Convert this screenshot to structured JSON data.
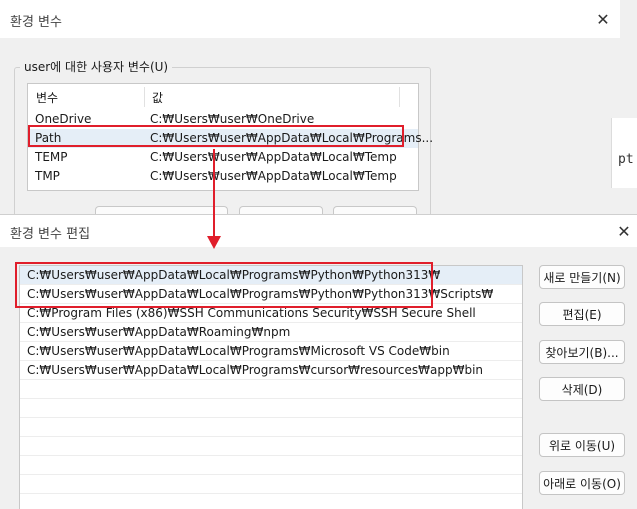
{
  "back_window": {
    "title": "환경 변수",
    "group_label": "user에 대한 사용자 변수(U)",
    "columns": {
      "name": "변수",
      "value": "값"
    },
    "rows": [
      {
        "name": "OneDrive",
        "value": "C:₩Users₩user₩OneDrive"
      },
      {
        "name": "Path",
        "value": "C:₩Users₩user₩AppData₩Local₩Programs..."
      },
      {
        "name": "TEMP",
        "value": "C:₩Users₩user₩AppData₩Local₩Temp"
      },
      {
        "name": "TMP",
        "value": "C:₩Users₩user₩AppData₩Local₩Temp"
      }
    ],
    "peek_text": "pt"
  },
  "edit_window": {
    "title": "환경 변수 편집",
    "paths": [
      "C:₩Users₩user₩AppData₩Local₩Programs₩Python₩Python313₩",
      "C:₩Users₩user₩AppData₩Local₩Programs₩Python₩Python313₩Scripts₩",
      "C:₩Program Files (x86)₩SSH Communications Security₩SSH Secure Shell",
      "C:₩Users₩user₩AppData₩Roaming₩npm",
      "C:₩Users₩user₩AppData₩Local₩Programs₩Microsoft VS Code₩bin",
      "C:₩Users₩user₩AppData₩Local₩Programs₩cursor₩resources₩app₩bin"
    ],
    "buttons": {
      "new": "새로 만들기(N)",
      "edit": "편집(E)",
      "browse": "찾아보기(B)...",
      "delete": "삭제(D)",
      "move_up": "위로 이동(U)",
      "move_down": "아래로 이동(O)"
    }
  },
  "colors": {
    "annotation": "#e01e2b",
    "selection": "#e5eef7"
  }
}
